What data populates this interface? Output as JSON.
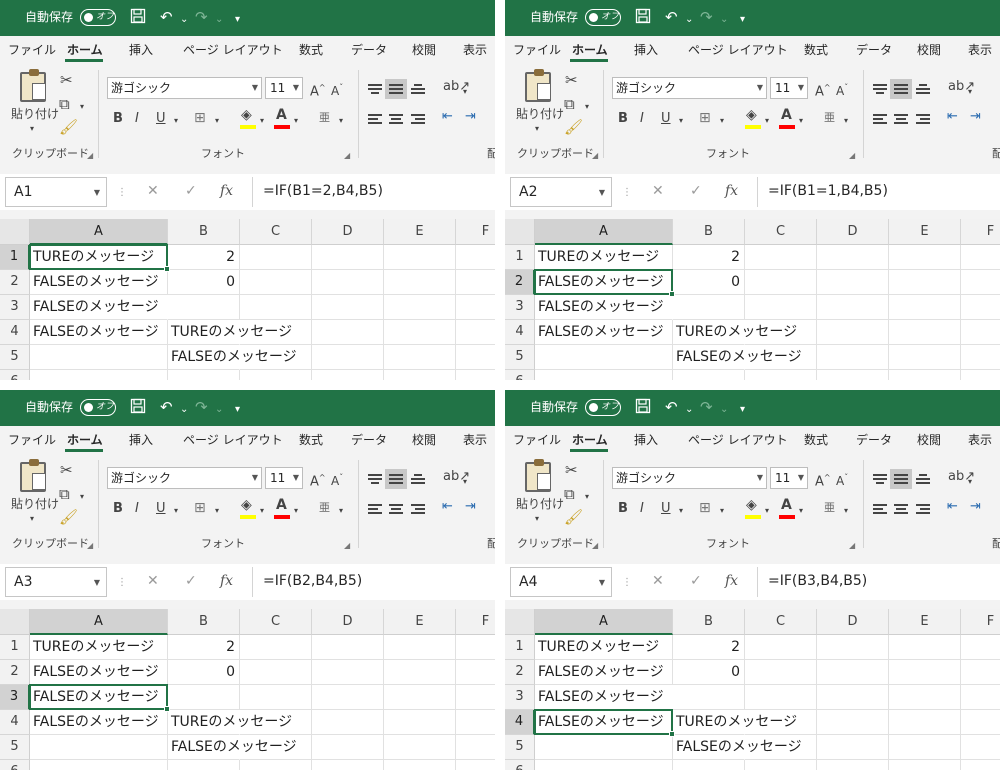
{
  "titlebar": {
    "autosave_label": "自動保存",
    "autosave_state": "オフ",
    "icons": [
      "save-icon",
      "undo-icon",
      "redo-icon",
      "customize-qat-icon"
    ]
  },
  "tabs": [
    {
      "label": "ファイル",
      "active": false
    },
    {
      "label": "ホーム",
      "active": true
    },
    {
      "label": "挿入",
      "active": false
    },
    {
      "label": "ページ レイアウト",
      "active": false
    },
    {
      "label": "数式",
      "active": false
    },
    {
      "label": "データ",
      "active": false
    },
    {
      "label": "校閲",
      "active": false
    },
    {
      "label": "表示",
      "active": false
    }
  ],
  "ribbon": {
    "paste_label": "貼り付け",
    "clipboard_group": "クリップボード",
    "font_name": "游ゴシック",
    "font_size": "11",
    "font_group": "フォント",
    "bold": "B",
    "italic": "I",
    "underline": "U",
    "grow_font": "A",
    "shrink_font": "A",
    "font_color_letter": "A",
    "phonetic": "亜",
    "alignment_group_partial": "配",
    "colors": {
      "highlight": "#ffff00",
      "font_color": "#ff0000",
      "accent": "#217346"
    }
  },
  "grid": {
    "columns": [
      "A",
      "B",
      "C",
      "D",
      "E",
      "F"
    ],
    "rows": [
      "1",
      "2",
      "3",
      "4",
      "5",
      "6"
    ]
  },
  "panels": [
    {
      "name_box": "A1",
      "formula": "=IF(B1=2,B4,B5)",
      "selected": "A1",
      "cells": [
        [
          "TUREのメッセージ",
          "2"
        ],
        [
          "FALSEのメッセージ",
          "0"
        ],
        [
          "FALSEのメッセージ",
          ""
        ],
        [
          "FALSEのメッセージ",
          "TUREのメッセージ"
        ],
        [
          "",
          "FALSEのメッセージ"
        ]
      ]
    },
    {
      "name_box": "A2",
      "formula": "=IF(B1=1,B4,B5)",
      "selected": "A2",
      "cells": [
        [
          "TUREのメッセージ",
          "2"
        ],
        [
          "FALSEのメッセージ",
          "0"
        ],
        [
          "FALSEのメッセージ",
          ""
        ],
        [
          "FALSEのメッセージ",
          "TUREのメッセージ"
        ],
        [
          "",
          "FALSEのメッセージ"
        ]
      ]
    },
    {
      "name_box": "A3",
      "formula": "=IF(B2,B4,B5)",
      "selected": "A3",
      "cells": [
        [
          "TUREのメッセージ",
          "2"
        ],
        [
          "FALSEのメッセージ",
          "0"
        ],
        [
          "FALSEのメッセージ",
          ""
        ],
        [
          "FALSEのメッセージ",
          "TUREのメッセージ"
        ],
        [
          "",
          "FALSEのメッセージ"
        ]
      ]
    },
    {
      "name_box": "A4",
      "formula": "=IF(B3,B4,B5)",
      "selected": "A4",
      "cells": [
        [
          "TUREのメッセージ",
          "2"
        ],
        [
          "FALSEのメッセージ",
          "0"
        ],
        [
          "FALSEのメッセージ",
          ""
        ],
        [
          "FALSEのメッセージ",
          "TUREのメッセージ"
        ],
        [
          "",
          "FALSEのメッセージ"
        ]
      ]
    }
  ]
}
